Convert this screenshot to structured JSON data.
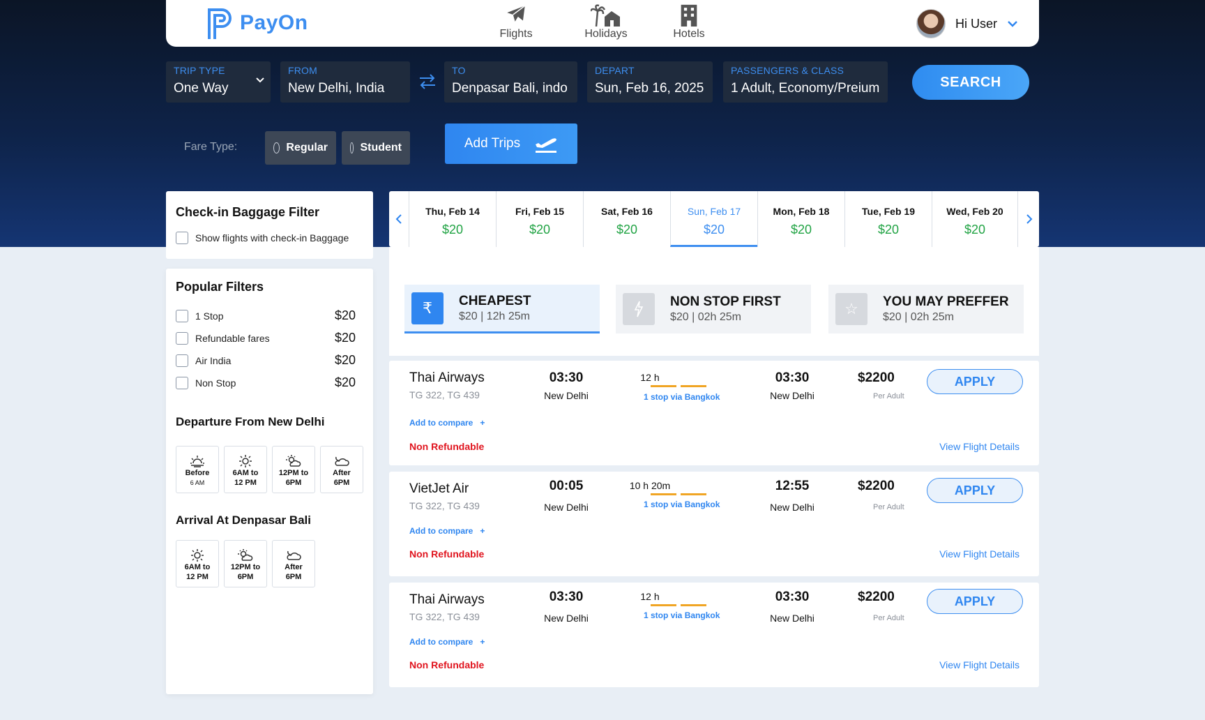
{
  "brand": {
    "name": "PayOn",
    "color": "#3d8ef0"
  },
  "nav": [
    {
      "label": "Flights",
      "icon": "airplane-icon"
    },
    {
      "label": "Holidays",
      "icon": "palm-tree-icon"
    },
    {
      "label": "Hotels",
      "icon": "hotel-building-icon"
    }
  ],
  "user": {
    "greeting": "Hi User"
  },
  "search": {
    "trip_type": {
      "label": "TRIP TYPE",
      "value": "One Way"
    },
    "from": {
      "label": "FROM",
      "value": "New Delhi, India"
    },
    "to": {
      "label": "TO",
      "value": "Denpasar Bali, indo"
    },
    "depart": {
      "label": "DEPART",
      "value": "Sun, Feb 16, 2025"
    },
    "passengers": {
      "label": "PASSENGERS & CLASS",
      "value": "1 Adult, Economy/Preium"
    },
    "button": "SEARCH"
  },
  "fare": {
    "label": "Fare Type:",
    "options": [
      "Regular",
      "Student"
    ]
  },
  "add_trips": "Add Trips",
  "baggage": {
    "title": "Check-in Baggage Filter",
    "option": "Show flights with check-in Baggage"
  },
  "popular": {
    "title": "Popular Filters",
    "items": [
      {
        "label": "1 Stop",
        "price": "$20"
      },
      {
        "label": "Refundable fares",
        "price": "$20"
      },
      {
        "label": "Air India",
        "price": "$20"
      },
      {
        "label": "Non Stop",
        "price": "$20"
      }
    ]
  },
  "departure": {
    "title": "Departure From New Delhi",
    "slots": [
      {
        "line1": "Before",
        "line2": "6 AM",
        "icon": "sunrise-icon"
      },
      {
        "line1": "6AM to",
        "line2": "12 PM",
        "icon": "sun-icon"
      },
      {
        "line1": "12PM to",
        "line2": "6PM",
        "icon": "sun-cloud-icon"
      },
      {
        "line1": "After",
        "line2": "6PM",
        "icon": "cloud-moon-icon"
      }
    ]
  },
  "arrival": {
    "title": "Arrival At Denpasar Bali",
    "slots": [
      {
        "line1": "6AM to",
        "line2": "12 PM",
        "icon": "sun-icon"
      },
      {
        "line1": "12PM to",
        "line2": "6PM",
        "icon": "sun-cloud-icon"
      },
      {
        "line1": "After",
        "line2": "6PM",
        "icon": "cloud-moon-icon"
      }
    ]
  },
  "dates": [
    {
      "day": "Thu, Feb 14",
      "price": "$20"
    },
    {
      "day": "Fri, Feb 15",
      "price": "$20"
    },
    {
      "day": "Sat, Feb 16",
      "price": "$20"
    },
    {
      "day": "Sun, Feb 17",
      "price": "$20",
      "selected": true
    },
    {
      "day": "Mon, Feb 18",
      "price": "$20"
    },
    {
      "day": "Tue, Feb 19",
      "price": "$20"
    },
    {
      "day": "Wed, Feb 20",
      "price": "$20"
    }
  ],
  "sort": [
    {
      "title": "CHEAPEST",
      "sub": "$20 | 12h 25m",
      "icon": "rupee-icon",
      "selected": true
    },
    {
      "title": "NON STOP FIRST",
      "sub": "$20 | 02h 25m",
      "icon": "lightning-icon"
    },
    {
      "title": "YOU MAY PREFFER",
      "sub": "$20 | 02h 25m",
      "icon": "star-icon"
    }
  ],
  "flights": [
    {
      "airline": "Thai Airways",
      "codes": "TG 322, TG 439",
      "dep_time": "03:30",
      "dep_city": "New Delhi",
      "duration": "12 h",
      "stops": "1 stop via Bangkok",
      "arr_time": "03:30",
      "arr_city": "New Delhi",
      "price": "$2200",
      "per": "Per Adult",
      "apply": "APPLY",
      "compare": "Add to compare",
      "refund": "Non Refundable",
      "details": "View Flight Details"
    },
    {
      "airline": "VietJet Air",
      "codes": "TG 322, TG 439",
      "dep_time": "00:05",
      "dep_city": "New Delhi",
      "duration": "10 h 20m",
      "stops": "1 stop via Bangkok",
      "arr_time": "12:55",
      "arr_city": "New Delhi",
      "price": "$2200",
      "per": "Per Adult",
      "apply": "APPLY",
      "compare": "Add to compare",
      "refund": "Non Refundable",
      "details": "View Flight Details"
    },
    {
      "airline": "Thai Airways",
      "codes": "TG 322, TG 439",
      "dep_time": "03:30",
      "dep_city": "New Delhi",
      "duration": "12 h",
      "stops": "1 stop via Bangkok",
      "arr_time": "03:30",
      "arr_city": "New Delhi",
      "price": "$2200",
      "per": "Per Adult",
      "apply": "APPLY",
      "compare": "Add to compare",
      "refund": "Non Refundable",
      "details": "View Flight Details"
    }
  ]
}
